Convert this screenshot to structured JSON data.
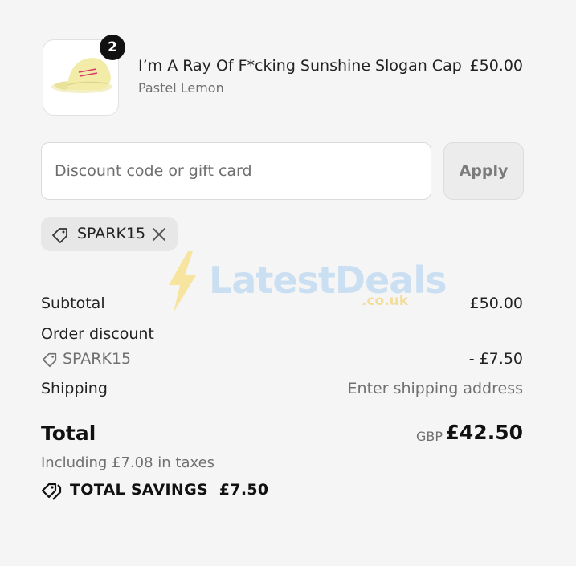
{
  "product": {
    "quantity": "2",
    "title": "I’m A Ray Of F*cking Sunshine Slogan Cap",
    "variant": "Pastel Lemon",
    "price": "£50.00",
    "image_text": "I'M A RAY OF F*CKING SUNSHINE"
  },
  "discount": {
    "placeholder": "Discount code or gift card",
    "apply_label": "Apply",
    "applied_code": "SPARK15"
  },
  "watermark": {
    "brand": "LatestDeals",
    "domain": ".co.uk"
  },
  "summary": {
    "subtotal_label": "Subtotal",
    "subtotal_value": "£50.00",
    "order_discount_label": "Order discount",
    "discount_code": "SPARK15",
    "discount_value": "- £7.50",
    "shipping_label": "Shipping",
    "shipping_value": "Enter shipping address",
    "total_label": "Total",
    "currency": "GBP",
    "total_value": "£42.50",
    "tax_note": "Including £7.08 in taxes",
    "savings_label": "TOTAL SAVINGS  £7.50"
  },
  "colors": {
    "background": "#f5f5f5",
    "text": "#1f1f1f",
    "muted": "#707070",
    "badge": "#111111",
    "cap": "#f2eca8"
  },
  "icons": [
    "tag-icon",
    "close-icon",
    "savings-tags-icon",
    "bolt-icon"
  ]
}
